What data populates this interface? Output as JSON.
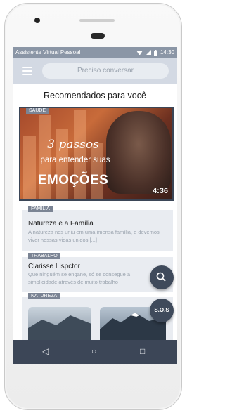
{
  "status_bar": {
    "app_name": "Assistente Virtual Pessoal",
    "time": "14:30"
  },
  "app_bar": {
    "search_placeholder": "Preciso conversar"
  },
  "recommended": {
    "title": "Recomendados para você",
    "featured": {
      "category": "SAÚDE",
      "line1": "3 passos",
      "line2": "para entender suas",
      "line3": "EMOÇÕES",
      "duration": "4:36"
    },
    "items": [
      {
        "category": "FAMÍLIA",
        "title": "Natureza e a Família",
        "description": "A natureza nos uniu em uma imensa família, e devemos viver nossas vidas unidos [...]"
      },
      {
        "category": "TRABALHO",
        "title": "Clarisse Lispctor",
        "description": "Que ninguém se engane, só se consegue a simplicidade através de muito trabalho"
      },
      {
        "category": "NATUREZA"
      }
    ]
  },
  "fab": {
    "search": "search-icon",
    "sos_label": "S.O.S"
  },
  "nav": {
    "back": "◁",
    "home": "○",
    "recents": "□"
  }
}
